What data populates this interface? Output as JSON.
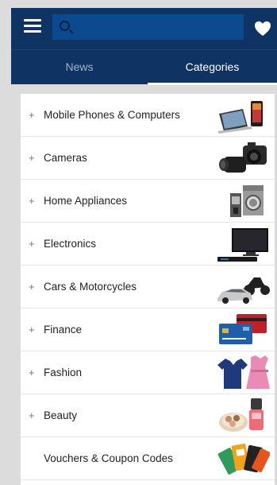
{
  "header": {
    "menu_icon": "hamburger-menu-icon",
    "search_icon": "search-icon",
    "search_value": "",
    "favorite_icon": "heart-icon"
  },
  "tabs": [
    {
      "label": "News",
      "active": false
    },
    {
      "label": "Categories",
      "active": true
    }
  ],
  "categories": [
    {
      "label": "Mobile Phones & Computers",
      "expandable": true,
      "expander": "+",
      "image": "tablet-and-phone-image"
    },
    {
      "label": "Cameras",
      "expandable": true,
      "expander": "+",
      "image": "cameras-image"
    },
    {
      "label": "Home Appliances",
      "expandable": true,
      "expander": "+",
      "image": "appliances-image"
    },
    {
      "label": "Electronics",
      "expandable": true,
      "expander": "+",
      "image": "tv-image"
    },
    {
      "label": "Cars & Motorcycles",
      "expandable": true,
      "expander": "+",
      "image": "car-motorcycle-image"
    },
    {
      "label": "Finance",
      "expandable": true,
      "expander": "+",
      "image": "credit-cards-image"
    },
    {
      "label": "Fashion",
      "expandable": true,
      "expander": "+",
      "image": "clothing-image"
    },
    {
      "label": "Beauty",
      "expandable": true,
      "expander": "+",
      "image": "cosmetics-image"
    },
    {
      "label": "Vouchers & Coupon Codes",
      "expandable": false,
      "expander": "",
      "image": "vouchers-image"
    }
  ],
  "colors": {
    "header_bg": "#0f3463",
    "search_bg": "#0b4a8f",
    "active_tab": "#ffffff",
    "inactive_tab": "#9fb1c9",
    "page_bg": "#dcdcdc"
  }
}
